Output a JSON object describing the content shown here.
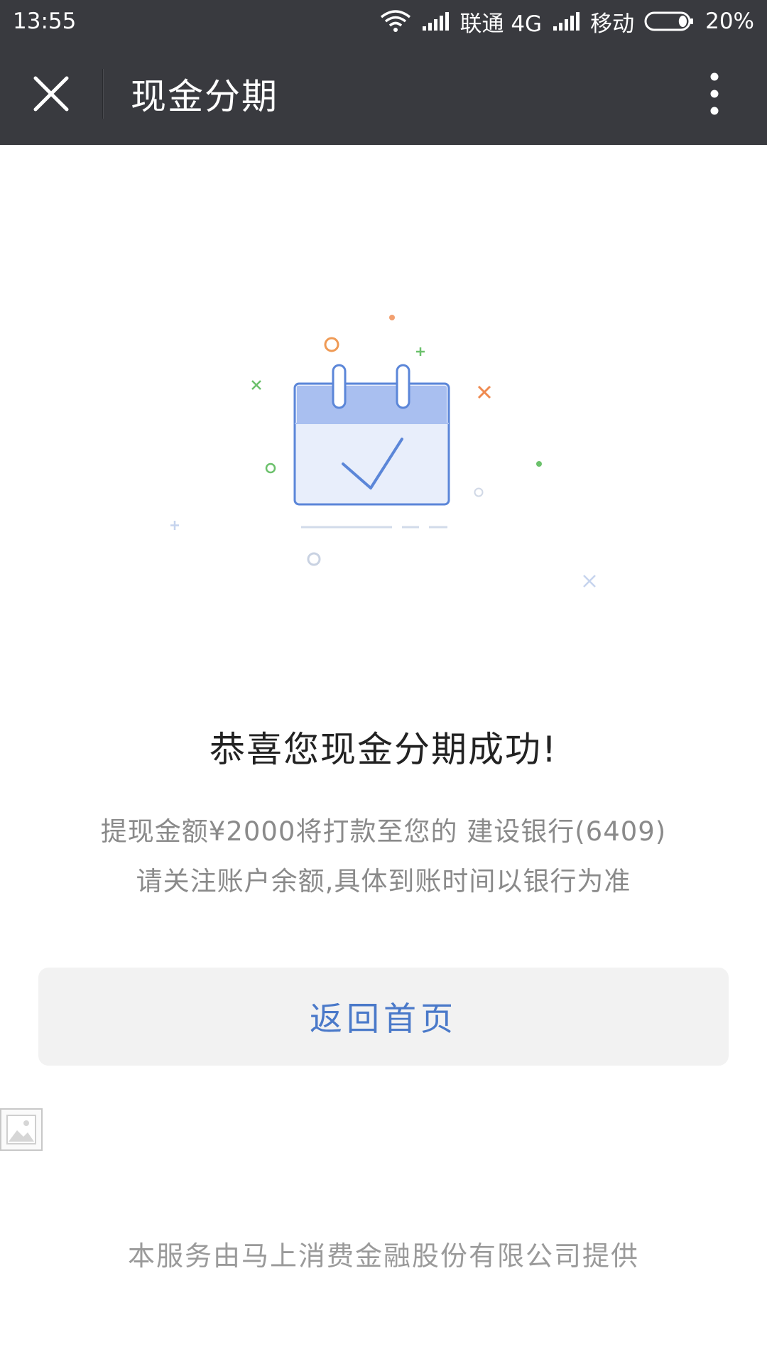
{
  "status_bar": {
    "time": "13:55",
    "carrier_1": "联通 4G",
    "carrier_2": "移动",
    "battery_percent": "20%",
    "battery_level": 0.2
  },
  "nav": {
    "title": "现金分期",
    "close_icon": "close-icon",
    "more_icon": "more-vertical-icon"
  },
  "illustration": {
    "icon": "calendar-check-icon",
    "primary_color": "#5b86d8",
    "fill_color": "#e8eefb",
    "header_color": "#a9bff0"
  },
  "result": {
    "title": "恭喜您现金分期成功!",
    "detail_line_1": "提现金额¥2000将打款至您的 建设银行(6409)",
    "detail_line_2": "请关注账户余额,具体到账时间以银行为准"
  },
  "actions": {
    "home_button": "返回首页"
  },
  "footer": {
    "text": "本服务由马上消费金融股份有限公司提供"
  },
  "colors": {
    "bar_background": "#393a3f",
    "button_text": "#4a79c9",
    "button_background": "#f2f2f2"
  }
}
